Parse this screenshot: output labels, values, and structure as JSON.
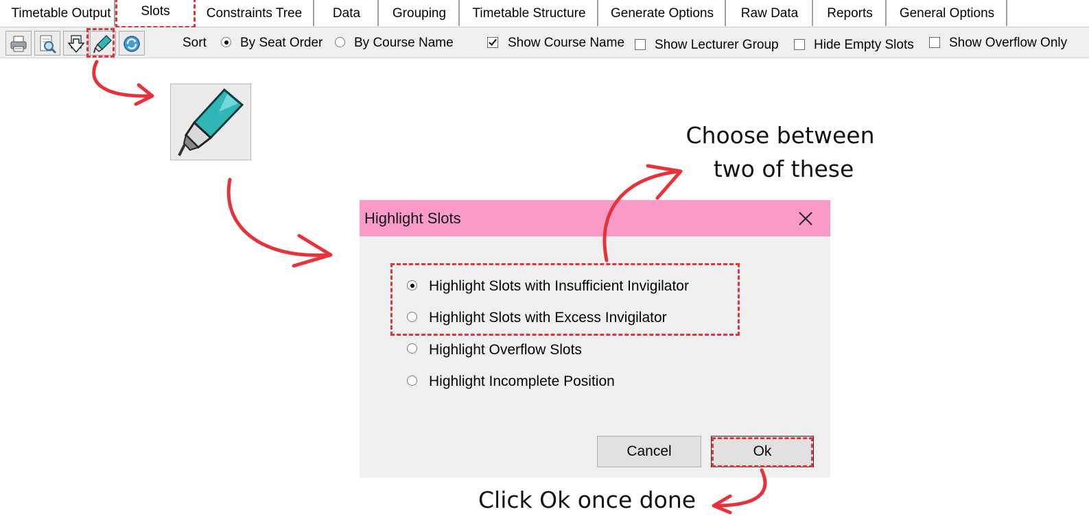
{
  "tabs": [
    "Timetable Output",
    "Slots",
    "Constraints Tree",
    "Data",
    "Grouping",
    "Timetable Structure",
    "Generate Options",
    "Raw Data",
    "Reports",
    "General Options"
  ],
  "toolbar": {
    "sort_label": "Sort",
    "sort_by_seat_order": "By Seat Order",
    "sort_by_course_name": "By Course Name",
    "sort_selected": "By Seat Order",
    "show_course_name": "Show Course Name",
    "show_course_name_checked": true,
    "show_lecturer_group": "Show Lecturer Group",
    "hide_empty_slots": "Hide Empty Slots",
    "show_overflow_only": "Show Overflow Only",
    "icons": [
      "print-icon",
      "print-preview-icon",
      "export-icon",
      "highlighter-icon",
      "refresh-icon"
    ]
  },
  "dialog": {
    "title": "Highlight Slots",
    "options": [
      "Highlight Slots with Insufficient Invigilator",
      "Highlight Slots with Excess Invigilator",
      "Highlight Overflow Slots",
      "Highlight Incomplete Position"
    ],
    "selected": "Highlight Slots with Insufficient Invigilator",
    "cancel_label": "Cancel",
    "ok_label": "Ok"
  },
  "annotations": {
    "choose_note_line1": "Choose between",
    "choose_note_line2": "two of these",
    "ok_note": "Click Ok once done",
    "accent_color": "#e8323a",
    "titlebar_color": "#f99ac8"
  }
}
